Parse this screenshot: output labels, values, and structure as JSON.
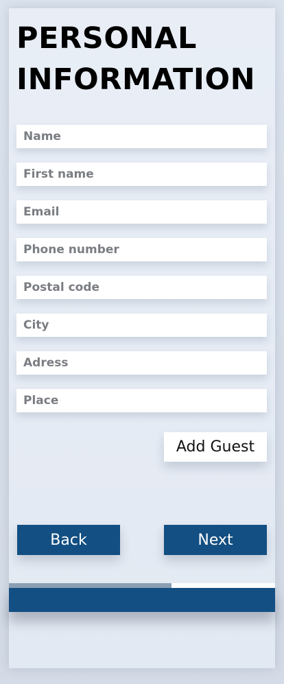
{
  "page": {
    "title": "PERSONAL INFORMATION"
  },
  "form": {
    "fields": [
      {
        "placeholder": "Name",
        "value": ""
      },
      {
        "placeholder": "First name",
        "value": ""
      },
      {
        "placeholder": "Email",
        "value": ""
      },
      {
        "placeholder": "Phone number",
        "value": ""
      },
      {
        "placeholder": "Postal code",
        "value": ""
      },
      {
        "placeholder": "City",
        "value": ""
      },
      {
        "placeholder": "Adress",
        "value": ""
      },
      {
        "placeholder": "Place",
        "value": ""
      }
    ],
    "add_guest_label": "Add Guest"
  },
  "nav": {
    "back_label": "Back",
    "next_label": "Next"
  },
  "progress": {
    "fraction": 0.61
  },
  "colors": {
    "primary": "#134f82",
    "background": "#e6ecf4",
    "field": "#ffffff",
    "progress_fill": "#8b9fb5"
  }
}
